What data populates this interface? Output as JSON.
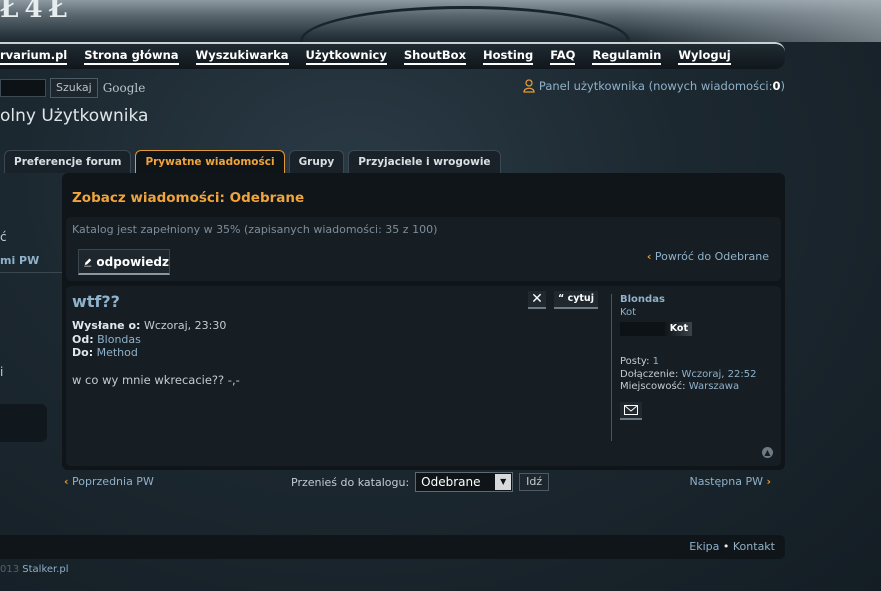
{
  "banner": {
    "logo_fragment": "Ł4Ł"
  },
  "nav": {
    "items": [
      {
        "label": "rvarium.pl"
      },
      {
        "label": "Strona główna"
      },
      {
        "label": "Wyszukiwarka"
      },
      {
        "label": "Użytkownicy"
      },
      {
        "label": "ShoutBox"
      },
      {
        "label": "Hosting"
      },
      {
        "label": "FAQ"
      },
      {
        "label": "Regulamin"
      },
      {
        "label": "Wyloguj"
      }
    ]
  },
  "search": {
    "button_label": "Szukaj",
    "google_label": "Google"
  },
  "user_panel": {
    "text": "Panel użytkownika (nowych wiadomości: ",
    "count": "0",
    "suffix": ")"
  },
  "page_title": "olny Użytkownika",
  "tabs": [
    {
      "label": "Preferencje forum",
      "active": false
    },
    {
      "label": "Prywatne wiadomości",
      "active": true
    },
    {
      "label": "Grupy",
      "active": false
    },
    {
      "label": "Przyjaciele i wrogowie",
      "active": false
    }
  ],
  "sidebar": {
    "frag1": "ć",
    "frag2": "mi PW",
    "frag3": "i"
  },
  "main": {
    "title": "Zobacz wiadomości: Odebrane",
    "folder_note": "Katalog jest zapełniony w 35% (zapisanych wiadomości: 35 z 100)",
    "reply_label": "odpowiedz",
    "back_label": "Powróć do Odebrane"
  },
  "message": {
    "subject": "wtf??",
    "sent_label": "Wysłane o:",
    "sent_value": "Wczoraj, 23:30",
    "from_label": "Od:",
    "from_value": "Blondas",
    "to_label": "Do:",
    "to_value": "Method",
    "body": "w co wy mnie wkrecacie?? -,-",
    "quote_label": "cytuj",
    "delete_glyph": "✕"
  },
  "profile": {
    "username": "Blondas",
    "rank": "Kot",
    "rank_badge": "Kot",
    "posts_label": "Posty:",
    "posts_value": "1",
    "joined_label": "Dołączenie:",
    "joined_value": "Wczoraj, 22:52",
    "location_label": "Miejscowość:",
    "location_value": "Warszawa"
  },
  "navigation": {
    "prev_label": "Poprzednia PW",
    "next_label": "Następna PW",
    "move_label": "Przenieś do katalogu:",
    "move_selected": "Odebrane",
    "go_label": "Idź"
  },
  "footer": {
    "team": "Ekipa",
    "separator": "•",
    "contact": "Kontakt"
  },
  "copyright": {
    "prefix": "013",
    "site": "Stalker.pl"
  },
  "colors": {
    "accent": "#f0a43c",
    "link": "#8fb1c9",
    "bg": "#1c2830"
  }
}
